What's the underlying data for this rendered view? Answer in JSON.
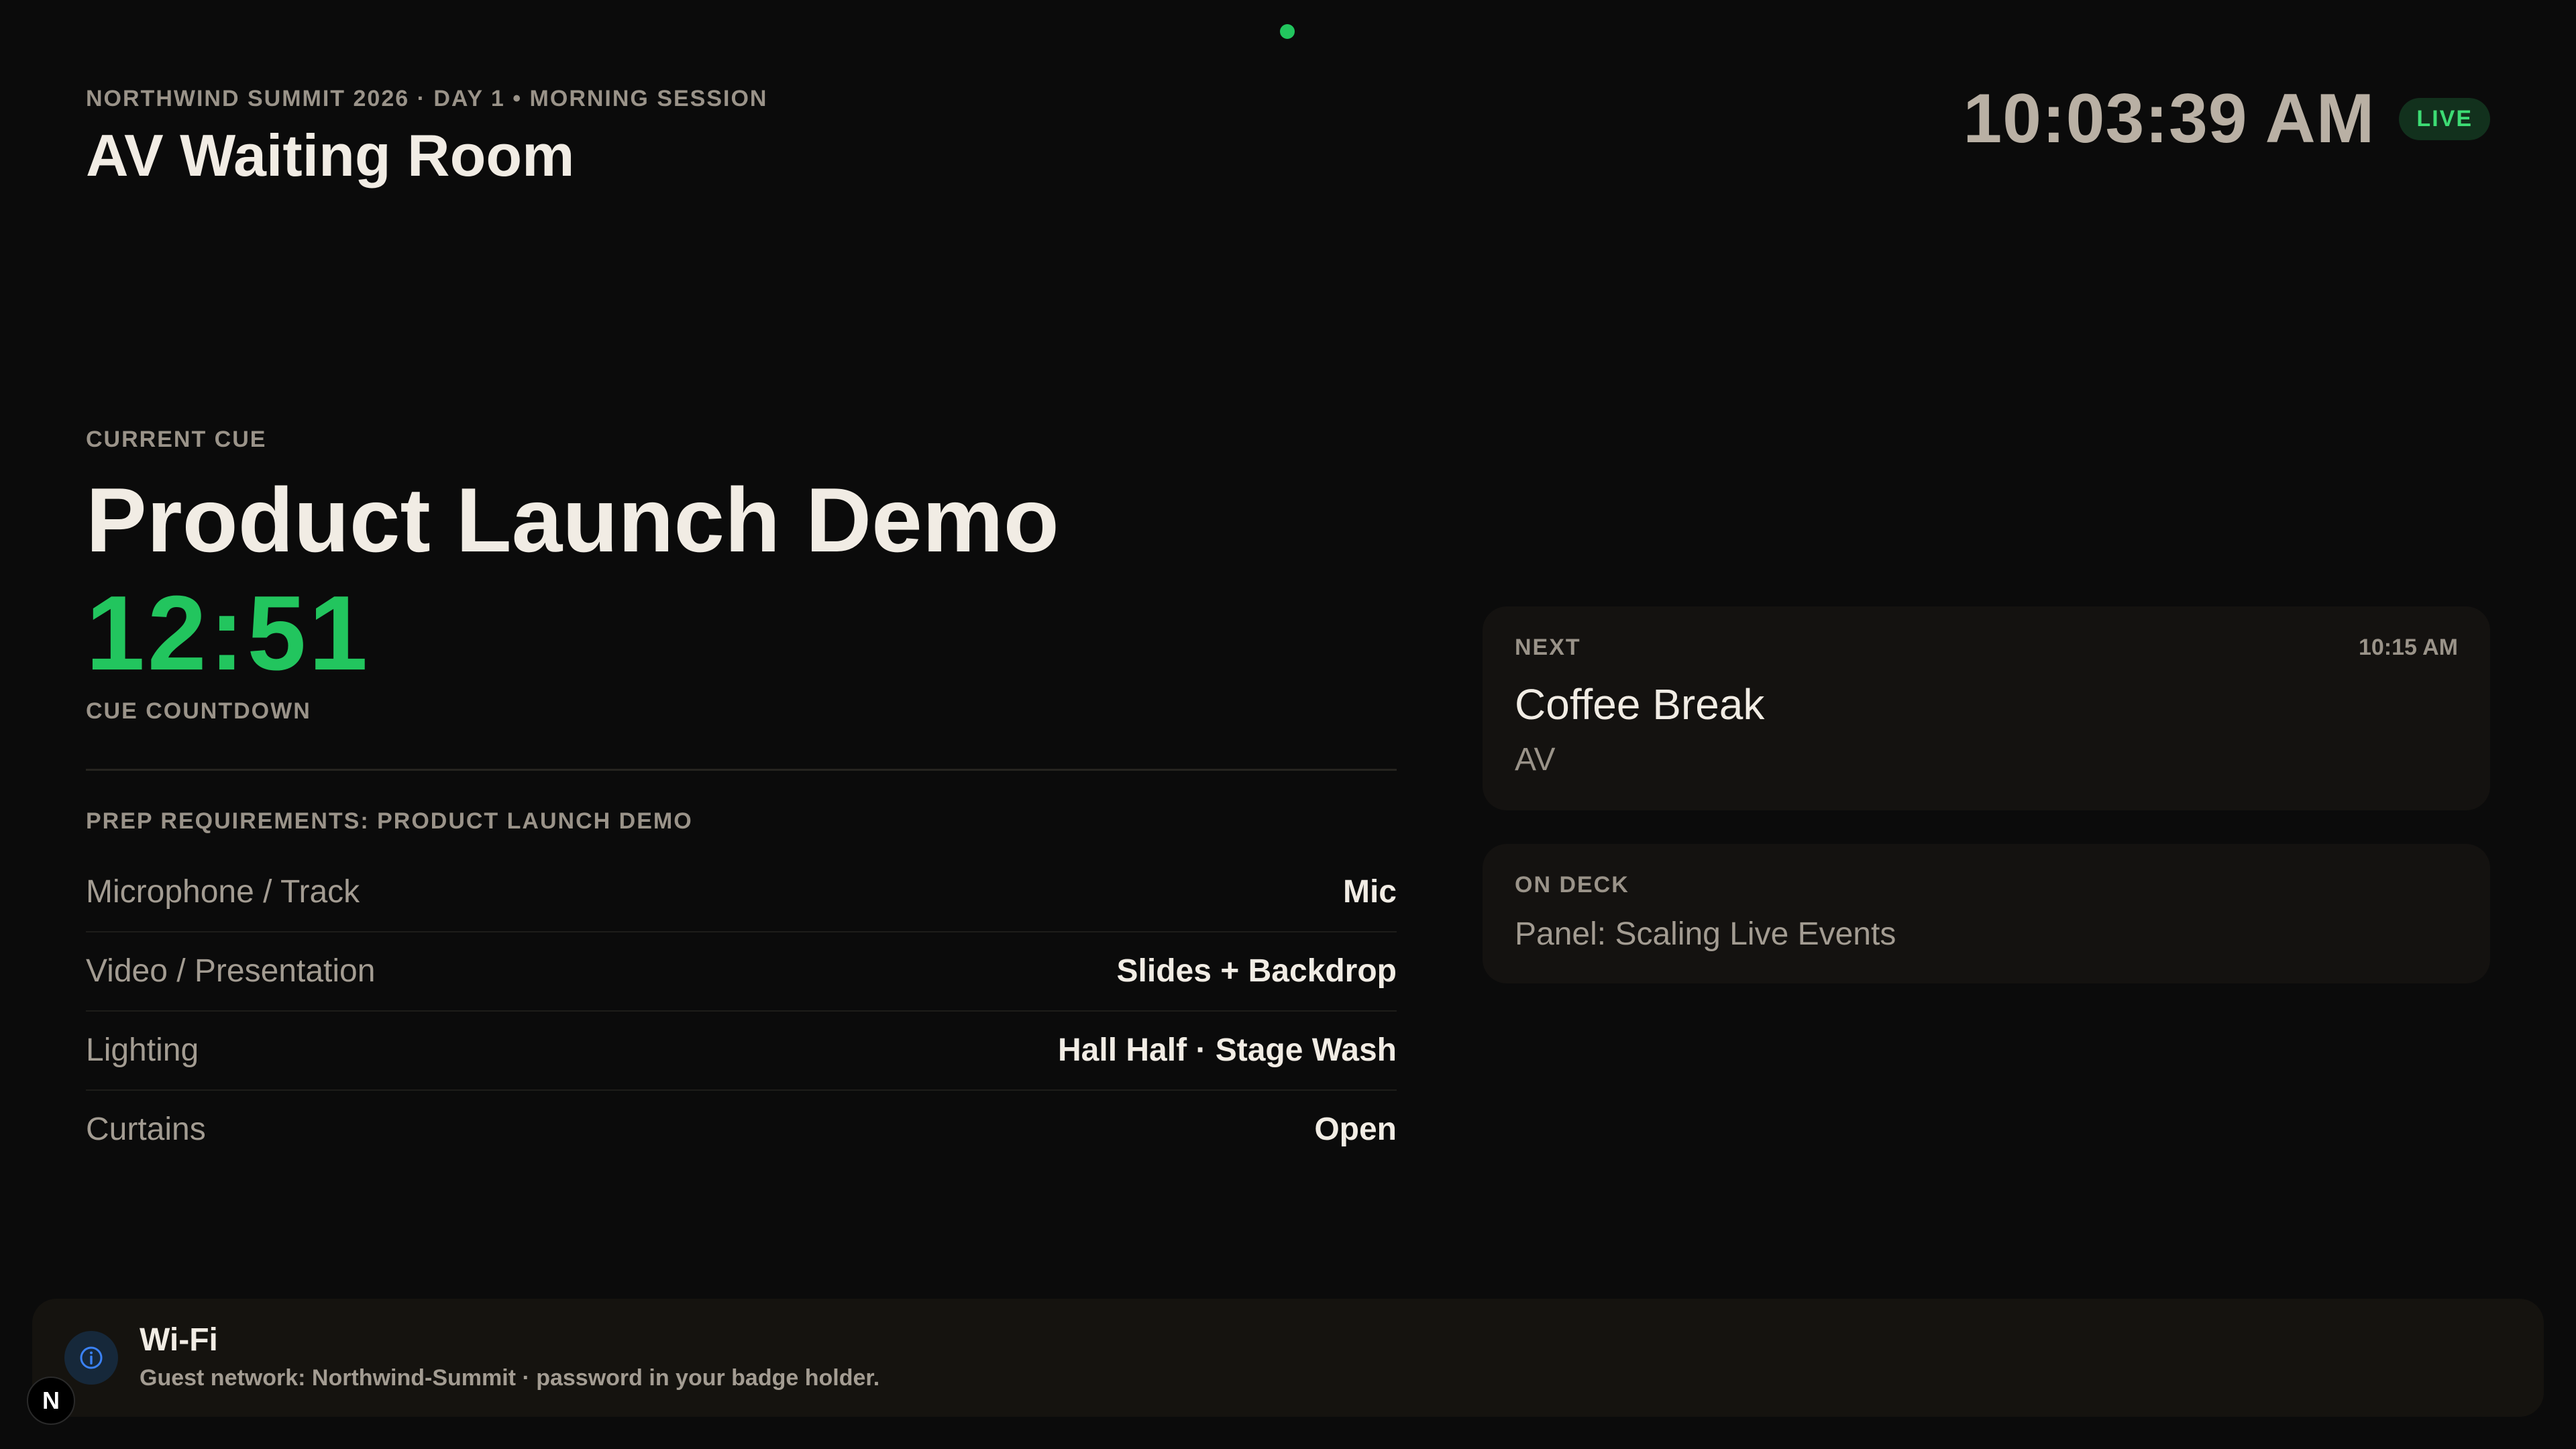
{
  "header": {
    "eyebrow": "NORTHWIND SUMMIT 2026 · DAY 1 • MORNING SESSION",
    "title": "AV Waiting Room",
    "clock": "10:03:39 AM",
    "live_label": "LIVE"
  },
  "current": {
    "label": "CURRENT CUE",
    "title": "Product Launch Demo",
    "countdown": "12:51",
    "countdown_label": "CUE COUNTDOWN"
  },
  "prep": {
    "title": "PREP REQUIREMENTS: PRODUCT LAUNCH DEMO",
    "items": [
      {
        "label": "Microphone / Track",
        "value": "Mic"
      },
      {
        "label": "Video / Presentation",
        "value": "Slides + Backdrop"
      },
      {
        "label": "Lighting",
        "value": "Hall Half · Stage Wash"
      },
      {
        "label": "Curtains",
        "value": "Open"
      }
    ]
  },
  "next": {
    "label": "NEXT",
    "time": "10:15 AM",
    "title": "Coffee Break",
    "subtitle": "AV"
  },
  "on_deck": {
    "label": "ON DECK",
    "title": "Panel: Scaling Live Events"
  },
  "footer": {
    "icon": "info-icon",
    "title": "Wi-Fi",
    "subtitle": "Guest network: Northwind-Summit · password in your badge holder."
  },
  "corner_badge": {
    "letter": "N"
  },
  "colors": {
    "accent_green": "#22c55e",
    "background": "#0b0b0b",
    "card": "#141210"
  }
}
